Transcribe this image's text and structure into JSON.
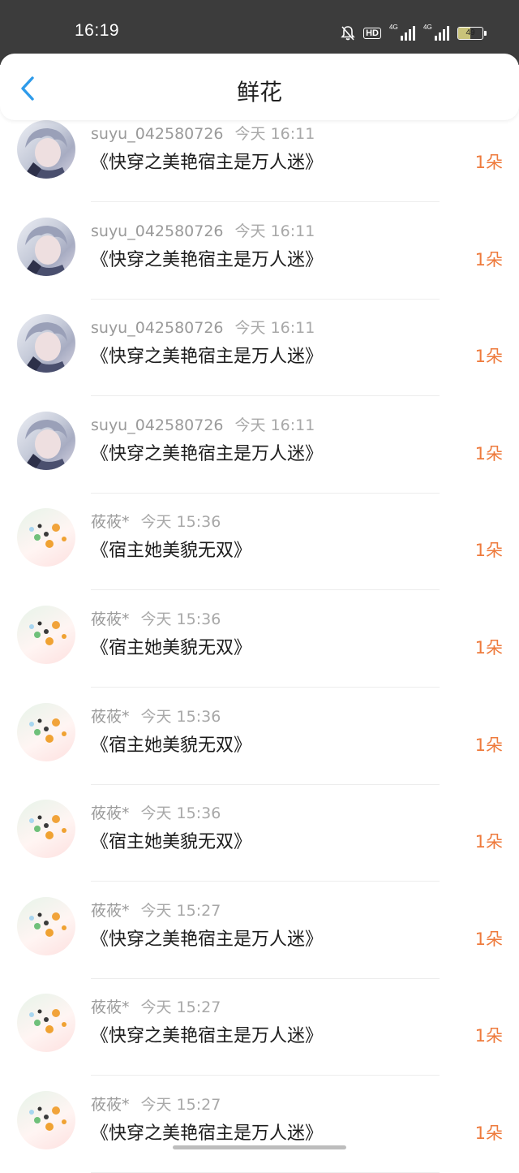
{
  "status_bar": {
    "time": "16:19",
    "hd": "HD",
    "net1": "4G",
    "net2": "4G",
    "battery": "49"
  },
  "header": {
    "title": "鲜花"
  },
  "items": [
    {
      "user": "suyu_042580726",
      "time": "今天 16:11",
      "book": "《快穿之美艳宿主是万人迷》",
      "count": "1朵",
      "avatar": "boy-avatar"
    },
    {
      "user": "suyu_042580726",
      "time": "今天 16:11",
      "book": "《快穿之美艳宿主是万人迷》",
      "count": "1朵",
      "avatar": "boy-avatar"
    },
    {
      "user": "suyu_042580726",
      "time": "今天 16:11",
      "book": "《快穿之美艳宿主是万人迷》",
      "count": "1朵",
      "avatar": "boy-avatar"
    },
    {
      "user": "suyu_042580726",
      "time": "今天 16:11",
      "book": "《快穿之美艳宿主是万人迷》",
      "count": "1朵",
      "avatar": "boy-avatar"
    },
    {
      "user": "莜莜*",
      "time": "今天 15:36",
      "book": "《宿主她美貌无双》",
      "count": "1朵",
      "avatar": "fruit-avatar"
    },
    {
      "user": "莜莜*",
      "time": "今天 15:36",
      "book": "《宿主她美貌无双》",
      "count": "1朵",
      "avatar": "fruit-avatar"
    },
    {
      "user": "莜莜*",
      "time": "今天 15:36",
      "book": "《宿主她美貌无双》",
      "count": "1朵",
      "avatar": "fruit-avatar"
    },
    {
      "user": "莜莜*",
      "time": "今天 15:36",
      "book": "《宿主她美貌无双》",
      "count": "1朵",
      "avatar": "fruit-avatar"
    },
    {
      "user": "莜莜*",
      "time": "今天 15:27",
      "book": "《快穿之美艳宿主是万人迷》",
      "count": "1朵",
      "avatar": "fruit-avatar"
    },
    {
      "user": "莜莜*",
      "time": "今天 15:27",
      "book": "《快穿之美艳宿主是万人迷》",
      "count": "1朵",
      "avatar": "fruit-avatar"
    },
    {
      "user": "莜莜*",
      "time": "今天 15:27",
      "book": "《快穿之美艳宿主是万人迷》",
      "count": "1朵",
      "avatar": "fruit-avatar"
    }
  ],
  "colors": {
    "accent": "#ee7a3c",
    "back_arrow": "#2e9bea",
    "status_bar_bg": "#3c3c3c"
  }
}
